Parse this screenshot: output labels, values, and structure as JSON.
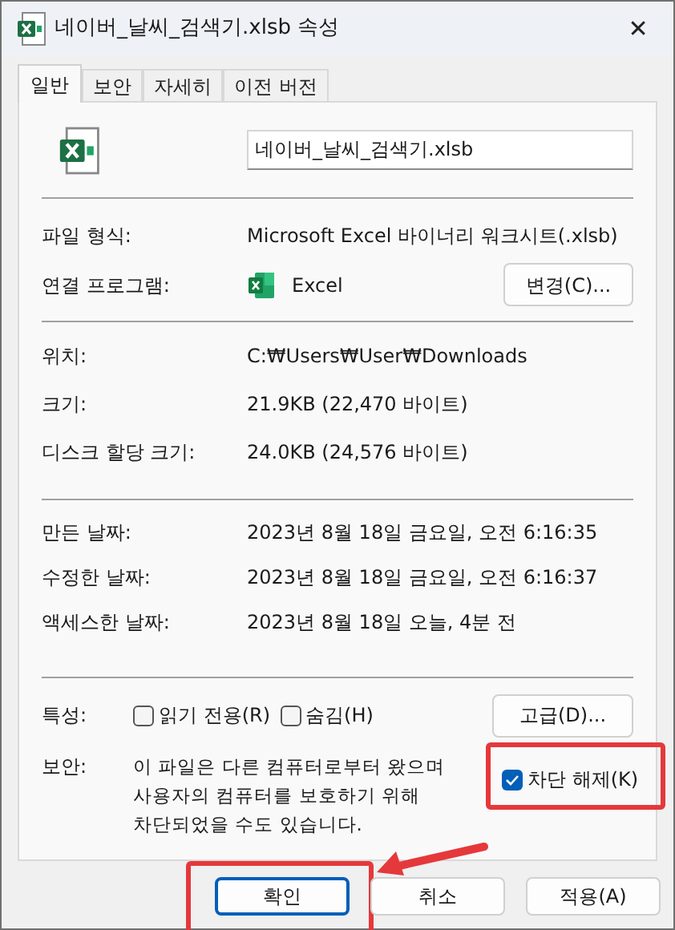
{
  "window": {
    "title": "네이버_날씨_검색기.xlsb 속성",
    "close": "✕"
  },
  "tabs": [
    {
      "label": "일반",
      "selected": true
    },
    {
      "label": "보안",
      "selected": false
    },
    {
      "label": "자세히",
      "selected": false
    },
    {
      "label": "이전 버전",
      "selected": false
    }
  ],
  "file_name": {
    "value": "네이버_날씨_검색기.xlsb"
  },
  "sections": [
    [
      {
        "label": "파일 형식:",
        "value": "Microsoft Excel 바이너리 워크시트(.xlsb)"
      },
      {
        "label": "연결 프로그램:",
        "value": "Excel",
        "kind": "program",
        "button": "변경(C)..."
      }
    ],
    [
      {
        "label": "위치:",
        "value": "C:₩Users₩User₩Downloads"
      },
      {
        "label": "크기:",
        "value": "21.9KB (22,470 바이트)"
      },
      {
        "label": "디스크 할당 크기:",
        "value": "24.0KB (24,576 바이트)"
      }
    ],
    [
      {
        "label": "만든 날짜:",
        "value": "2023년 8월 18일 금요일, 오전 6:16:35"
      },
      {
        "label": "수정한 날짜:",
        "value": "2023년 8월 18일 금요일, 오전 6:16:37"
      },
      {
        "label": "액세스한 날짜:",
        "value": "2023년 8월 18일 오늘, 4분 전"
      }
    ]
  ],
  "attributes": {
    "label": "특성:",
    "options": [
      {
        "label": "읽기 전용(R)",
        "checked": false
      },
      {
        "label": "숨김(H)",
        "checked": false
      }
    ],
    "button": "고급(D)..."
  },
  "security": {
    "label": "보안:",
    "text": "이 파일은 다른 컴퓨터로부터 왔으며 사용자의 컴퓨터를 보호하기 위해 차단되었을 수도 있습니다.",
    "unblock": {
      "label": "차단 해제(K)",
      "checked": true,
      "highlighted": true
    }
  },
  "buttons": [
    {
      "label": "확인",
      "default": true,
      "highlighted": true
    },
    {
      "label": "취소",
      "default": false,
      "highlighted": false
    },
    {
      "label": "적용(A)",
      "default": false,
      "highlighted": false
    }
  ]
}
